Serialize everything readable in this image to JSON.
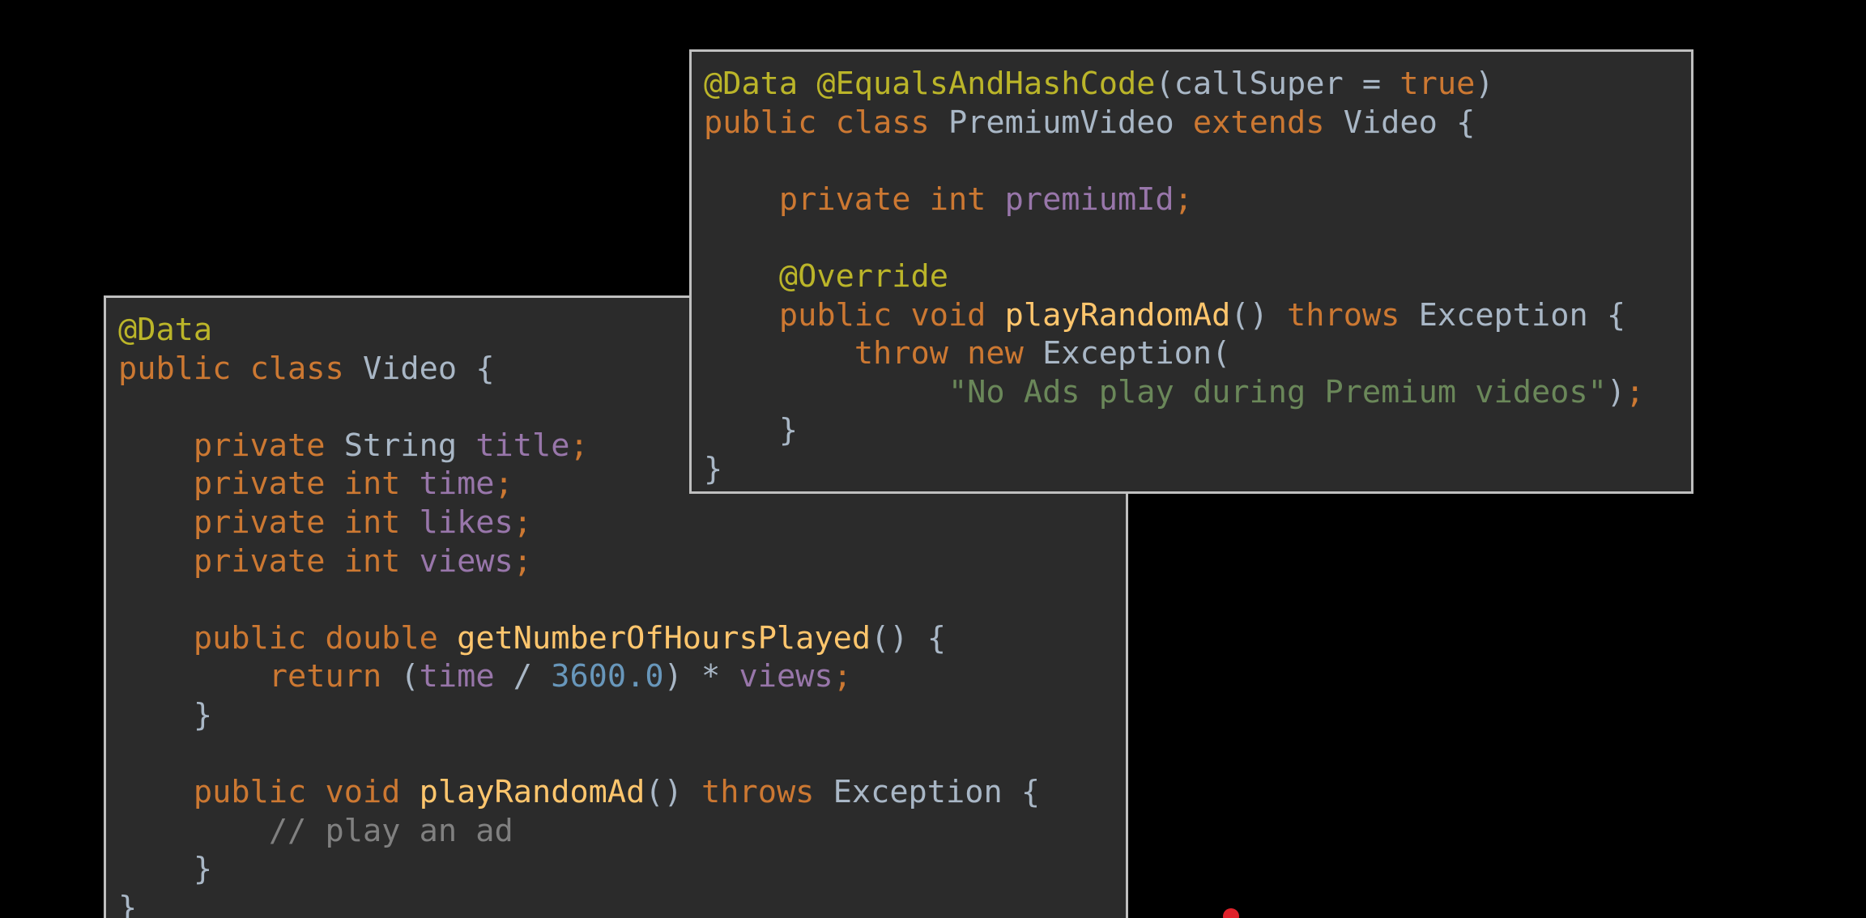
{
  "colors": {
    "background": "#000000",
    "panel_background": "#2b2b2b",
    "panel_border": "#bfbfbf",
    "annotation": "#bbb529",
    "keyword": "#cc7832",
    "type": "#a9b7c6",
    "field": "#9876aa",
    "method": "#ffc66d",
    "number": "#6897bb",
    "string": "#6a8759",
    "comment": "#808080",
    "cursor": "#e0222b"
  },
  "panels": [
    {
      "id": "panel-video",
      "name": "video-class-code-panel",
      "lines": [
        [
          [
            "ann",
            "@Data"
          ]
        ],
        [
          [
            "kw",
            "public "
          ],
          [
            "kw",
            "class "
          ],
          [
            "type",
            "Video "
          ],
          [
            "plain",
            "{"
          ]
        ],
        [],
        [
          [
            "plain",
            "    "
          ],
          [
            "kw",
            "private "
          ],
          [
            "type",
            "String "
          ],
          [
            "field",
            "title"
          ],
          [
            "kw",
            ";"
          ]
        ],
        [
          [
            "plain",
            "    "
          ],
          [
            "kw",
            "private "
          ],
          [
            "kw",
            "int "
          ],
          [
            "field",
            "time"
          ],
          [
            "kw",
            ";"
          ]
        ],
        [
          [
            "plain",
            "    "
          ],
          [
            "kw",
            "private "
          ],
          [
            "kw",
            "int "
          ],
          [
            "field",
            "likes"
          ],
          [
            "kw",
            ";"
          ]
        ],
        [
          [
            "plain",
            "    "
          ],
          [
            "kw",
            "private "
          ],
          [
            "kw",
            "int "
          ],
          [
            "field",
            "views"
          ],
          [
            "kw",
            ";"
          ]
        ],
        [],
        [
          [
            "plain",
            "    "
          ],
          [
            "kw",
            "public "
          ],
          [
            "kw",
            "double "
          ],
          [
            "method",
            "getNumberOfHoursPlayed"
          ],
          [
            "plain",
            "() {"
          ]
        ],
        [
          [
            "plain",
            "        "
          ],
          [
            "kw",
            "return "
          ],
          [
            "plain",
            "("
          ],
          [
            "field",
            "time"
          ],
          [
            "plain",
            " / "
          ],
          [
            "num",
            "3600.0"
          ],
          [
            "plain",
            ") * "
          ],
          [
            "field",
            "views"
          ],
          [
            "kw",
            ";"
          ]
        ],
        [
          [
            "plain",
            "    }"
          ]
        ],
        [],
        [
          [
            "plain",
            "    "
          ],
          [
            "kw",
            "public "
          ],
          [
            "kw",
            "void "
          ],
          [
            "method",
            "playRandomAd"
          ],
          [
            "plain",
            "() "
          ],
          [
            "kw",
            "throws "
          ],
          [
            "type",
            "Exception "
          ],
          [
            "plain",
            "{"
          ]
        ],
        [
          [
            "plain",
            "        "
          ],
          [
            "comment",
            "// play an ad"
          ]
        ],
        [
          [
            "plain",
            "    }"
          ]
        ],
        [
          [
            "plain",
            "}"
          ]
        ]
      ]
    },
    {
      "id": "panel-premium",
      "name": "premium-video-class-code-panel",
      "lines": [
        [
          [
            "ann",
            "@Data "
          ],
          [
            "ann",
            "@EqualsAndHashCode"
          ],
          [
            "plain",
            "(callSuper = "
          ],
          [
            "kw",
            "true"
          ],
          [
            "plain",
            ")"
          ]
        ],
        [
          [
            "kw",
            "public "
          ],
          [
            "kw",
            "class "
          ],
          [
            "type",
            "PremiumVideo "
          ],
          [
            "kw",
            "extends "
          ],
          [
            "type",
            "Video "
          ],
          [
            "plain",
            "{"
          ]
        ],
        [],
        [
          [
            "plain",
            "    "
          ],
          [
            "kw",
            "private "
          ],
          [
            "kw",
            "int "
          ],
          [
            "field",
            "premiumId"
          ],
          [
            "kw",
            ";"
          ]
        ],
        [],
        [
          [
            "plain",
            "    "
          ],
          [
            "ann",
            "@Override"
          ]
        ],
        [
          [
            "plain",
            "    "
          ],
          [
            "kw",
            "public "
          ],
          [
            "kw",
            "void "
          ],
          [
            "method",
            "playRandomAd"
          ],
          [
            "plain",
            "() "
          ],
          [
            "kw",
            "throws "
          ],
          [
            "type",
            "Exception "
          ],
          [
            "plain",
            "{"
          ]
        ],
        [
          [
            "plain",
            "        "
          ],
          [
            "kw",
            "throw "
          ],
          [
            "kw",
            "new "
          ],
          [
            "type",
            "Exception"
          ],
          [
            "plain",
            "("
          ]
        ],
        [
          [
            "plain",
            "             "
          ],
          [
            "str",
            "\"No Ads play during Premium videos\""
          ],
          [
            "plain",
            ")"
          ],
          [
            "kw",
            ";"
          ]
        ],
        [
          [
            "plain",
            "    }"
          ]
        ],
        [
          [
            "plain",
            "}"
          ]
        ]
      ]
    }
  ]
}
